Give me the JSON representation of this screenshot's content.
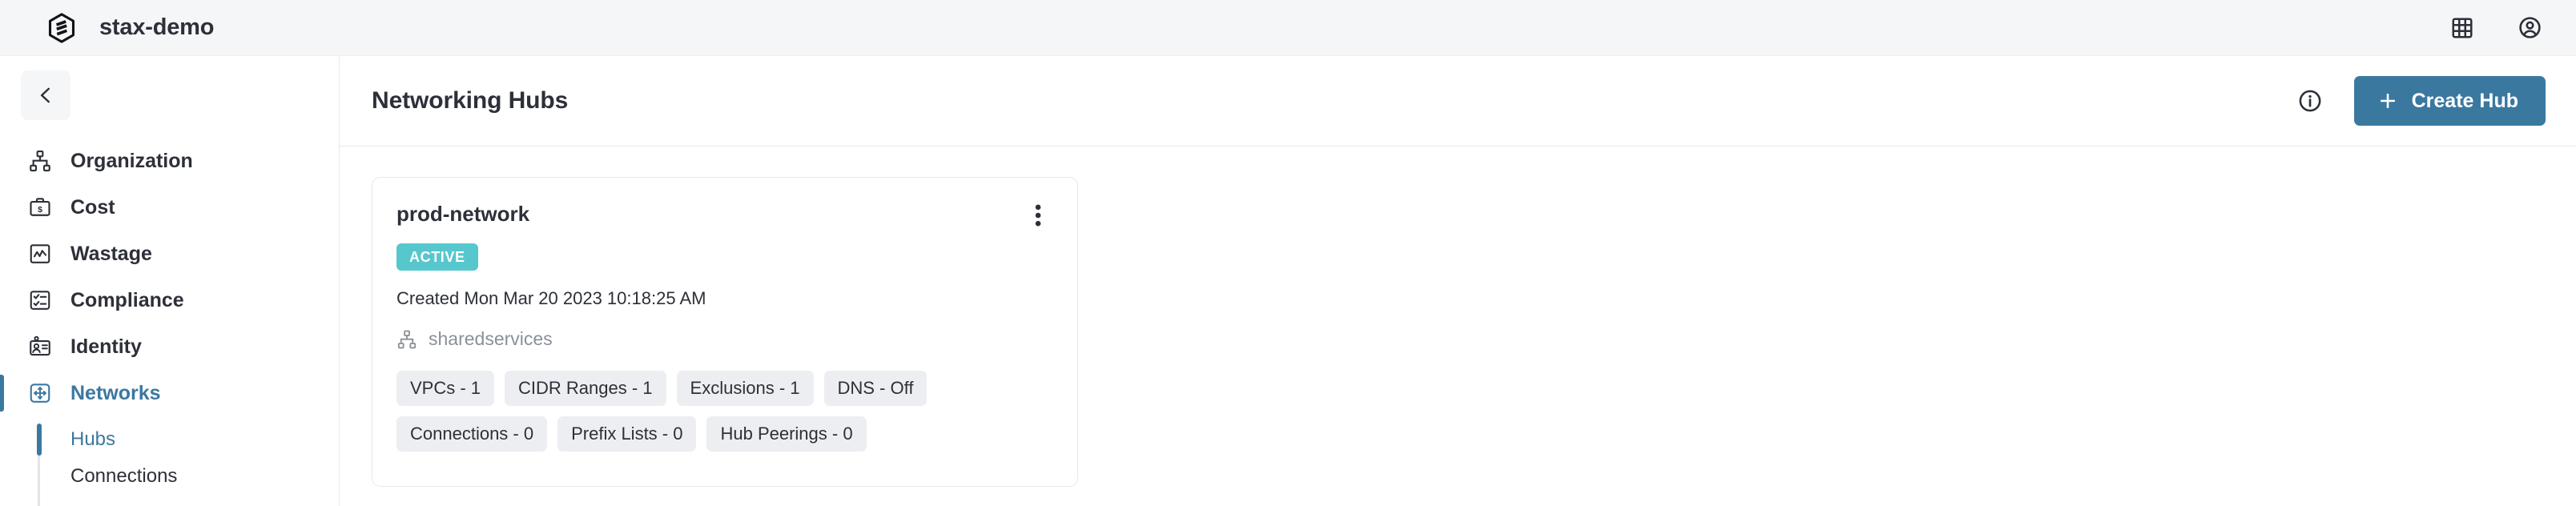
{
  "topbar": {
    "logo_icon": "stax-hexagon-logo",
    "org_name": "stax-demo",
    "actions": [
      {
        "icon": "grid-apps-icon",
        "name": "apps-grid-button"
      },
      {
        "icon": "account-circle-icon",
        "name": "account-button"
      }
    ]
  },
  "sidebar": {
    "back_button_icon": "chevron-left-icon",
    "items": [
      {
        "label": "Organization",
        "icon": "organization-hierarchy-icon",
        "active": false
      },
      {
        "label": "Cost",
        "icon": "briefcase-dollar-icon",
        "active": false
      },
      {
        "label": "Wastage",
        "icon": "chart-line-box-icon",
        "active": false
      },
      {
        "label": "Compliance",
        "icon": "checklist-box-icon",
        "active": false
      },
      {
        "label": "Identity",
        "icon": "id-card-icon",
        "active": false
      },
      {
        "label": "Networks",
        "icon": "network-move-arrows-icon",
        "active": true
      }
    ],
    "subitems": [
      {
        "label": "Hubs",
        "active": true
      },
      {
        "label": "Connections",
        "active": false
      }
    ]
  },
  "page": {
    "title": "Networking Hubs",
    "info_icon": "info-circle-icon",
    "create_button_label": "Create Hub",
    "create_button_icon": "plus-icon"
  },
  "cards": [
    {
      "title": "prod-network",
      "menu_icon": "kebab-vertical-icon",
      "status_badge": "ACTIVE",
      "created": "Created Mon Mar 20 2023 10:18:25 AM",
      "account_icon": "organization-hierarchy-icon",
      "account": "sharedservices",
      "tag_rows": [
        [
          "VPCs - 1",
          "CIDR Ranges - 1",
          "Exclusions - 1",
          "DNS - Off"
        ],
        [
          "Connections - 0",
          "Prefix Lists - 0",
          "Hub Peerings - 0"
        ]
      ]
    }
  ],
  "colors": {
    "accent_blue": "#3b78a0",
    "badge_teal": "#56c7cd",
    "topbar_bg": "#f5f6f8",
    "tag_bg": "#eceef1",
    "border": "#e6e8ec",
    "text": "#2d3038",
    "muted_text": "#8a9099"
  }
}
